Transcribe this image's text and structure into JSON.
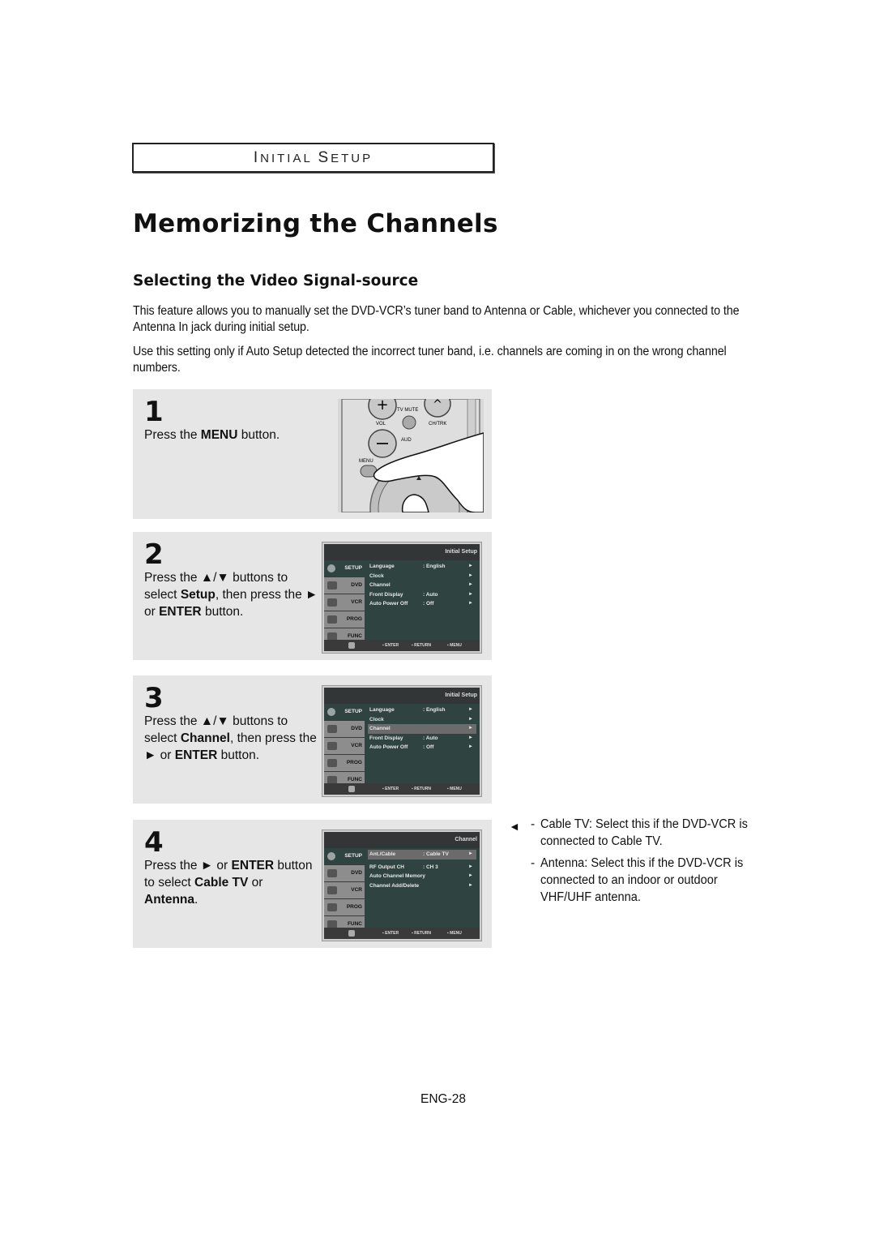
{
  "section_header": {
    "first_cap": "I",
    "first_rest": "NITIAL",
    "second_cap": "S",
    "second_rest": "ETUP"
  },
  "title": "Memorizing the Channels",
  "subtitle": "Selecting the Video Signal-source",
  "paragraphs": [
    "This feature allows you to manually set the DVD-VCR’s tuner band to Antenna or Cable, whichever you connected to the Antenna In jack during initial setup.",
    "Use this setting only if Auto Setup detected the incorrect tuner band, i.e. channels are coming in on the wrong channel numbers."
  ],
  "steps": [
    {
      "number": "1",
      "text": [
        {
          "t": "Press the "
        },
        {
          "t": "MENU",
          "b": true
        },
        {
          "t": " button."
        }
      ],
      "image": "remote-menu-button-press",
      "remote_labels": {
        "tv_mute": "TV MUTE",
        "vol": "VOL",
        "ch": "CH/TRK",
        "audio": "AUD",
        "menu": "MENU"
      }
    },
    {
      "number": "2",
      "text": [
        {
          "t": "Press the ▲/▼ buttons to select "
        },
        {
          "t": "Setup",
          "b": true
        },
        {
          "t": ", then press the ► or "
        },
        {
          "t": "ENTER",
          "b": true
        },
        {
          "t": " button."
        }
      ],
      "osd": {
        "header": "Initial Setup",
        "rows": [
          {
            "label": "Language",
            "value": ": English",
            "arrow": "►",
            "selected": false
          },
          {
            "label": "Clock",
            "value": "",
            "arrow": "►",
            "selected": false
          },
          {
            "label": "Channel",
            "value": "",
            "arrow": "►",
            "selected": false
          },
          {
            "label": "Front Display",
            "value": ": Auto",
            "arrow": "►",
            "selected": false
          },
          {
            "label": "Auto Power Off",
            "value": ": Off",
            "arrow": "►",
            "selected": false
          }
        ]
      }
    },
    {
      "number": "3",
      "text": [
        {
          "t": "Press the ▲/▼ buttons to select "
        },
        {
          "t": "Channel",
          "b": true
        },
        {
          "t": ", then press the ► or "
        },
        {
          "t": "ENTER",
          "b": true
        },
        {
          "t": " button."
        }
      ],
      "osd": {
        "header": "Initial Setup",
        "rows": [
          {
            "label": "Language",
            "value": ": English",
            "arrow": "►",
            "selected": false
          },
          {
            "label": "Clock",
            "value": "",
            "arrow": "►",
            "selected": false
          },
          {
            "label": "Channel",
            "value": "",
            "arrow": "►",
            "selected": true
          },
          {
            "label": "Front Display",
            "value": ": Auto",
            "arrow": "►",
            "selected": false
          },
          {
            "label": "Auto Power Off",
            "value": ": Off",
            "arrow": "►",
            "selected": false
          }
        ]
      }
    },
    {
      "number": "4",
      "text": [
        {
          "t": "Press the ► or "
        },
        {
          "t": "ENTER",
          "b": true
        },
        {
          "t": " button to select "
        },
        {
          "t": "Cable TV",
          "b": true
        },
        {
          "t": " or "
        },
        {
          "t": "Antenna",
          "b": true
        },
        {
          "t": "."
        }
      ],
      "osd": {
        "header": "Channel",
        "rows": [
          {
            "label": "Ant./Cable",
            "value": ": Cable TV",
            "arrow": "►",
            "selected": true
          },
          {
            "label": "RF Output CH",
            "value": ": CH 3",
            "arrow": "►",
            "selected": false,
            "gap": true
          },
          {
            "label": "Auto Channel Memory",
            "value": "",
            "arrow": "►",
            "selected": false
          },
          {
            "label": "Channel Add/Delete",
            "value": "",
            "arrow": "►",
            "selected": false
          }
        ]
      }
    }
  ],
  "osd_sidebar": [
    "SETUP",
    "DVD",
    "VCR",
    "PROG",
    "FUNC"
  ],
  "osd_footer": {
    "enter": "ENTER",
    "return": "RETURN",
    "menu": "MENU"
  },
  "notes": {
    "pointer": "◄",
    "items": [
      "Cable TV: Select this if the DVD-VCR is connected to Cable TV.",
      "Antenna: Select this if the DVD-VCR is connected to an indoor or outdoor VHF/UHF antenna."
    ]
  },
  "page_number": "ENG-28"
}
